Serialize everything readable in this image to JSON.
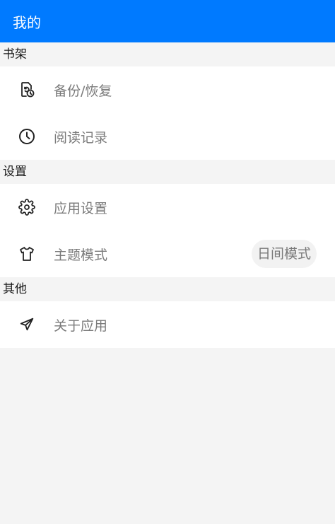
{
  "header": {
    "title": "我的"
  },
  "sections": [
    {
      "title": "书架",
      "items": [
        {
          "label": "备份/恢复",
          "icon": "backup-restore-icon"
        },
        {
          "label": "阅读记录",
          "icon": "clock-icon"
        }
      ]
    },
    {
      "title": "设置",
      "items": [
        {
          "label": "应用设置",
          "icon": "gear-icon"
        },
        {
          "label": "主题模式",
          "icon": "tshirt-icon",
          "value": "日间模式"
        }
      ]
    },
    {
      "title": "其他",
      "items": [
        {
          "label": "关于应用",
          "icon": "paper-plane-icon"
        }
      ]
    }
  ],
  "colors": {
    "accent": "#007aff",
    "background": "#f4f4f4",
    "row_background": "#ffffff",
    "label_text": "#7a7a7a"
  }
}
